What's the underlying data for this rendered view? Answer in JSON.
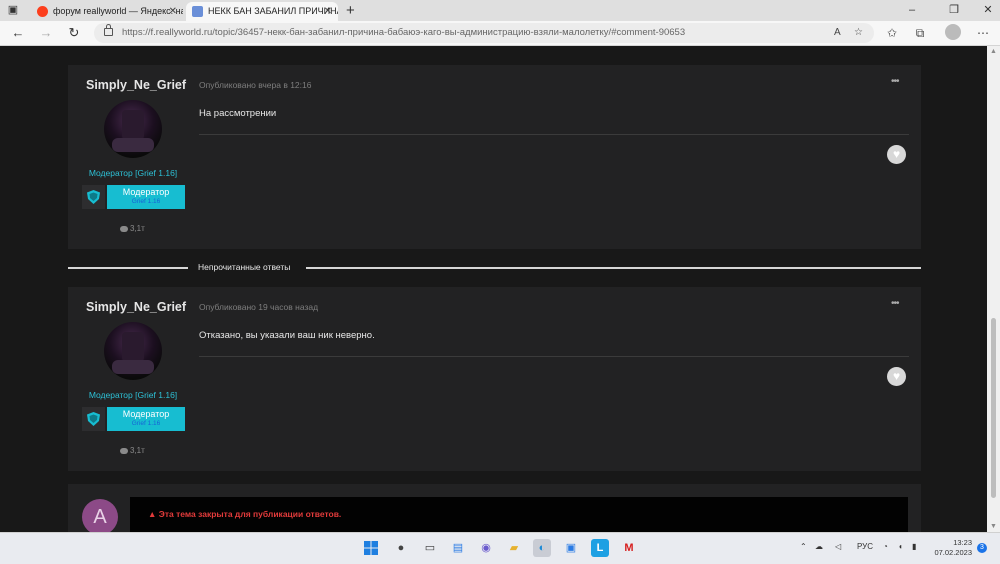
{
  "browser": {
    "tabs": [
      {
        "title": "форум reallyworld — Яндекс: на",
        "active": false
      },
      {
        "title": "НЕКК БАН ЗАБАНИЛ ПРИЧИНА",
        "active": true
      }
    ],
    "url": "https://f.reallyworld.ru/topic/36457-некк-бан-забанил-причина-бабаюэ-каго-вы-администрацию-взяли-малолетку/#comment-90653"
  },
  "posts": [
    {
      "author": "Simply_Ne_Grief",
      "role": "Модератор [Grief 1.16]",
      "badge_title": "Модератор",
      "badge_sub": "Grief 1.16",
      "replies": "3,1т",
      "meta": "Опубликовано вчера в 12:16",
      "body": "На рассмотрении"
    },
    {
      "author": "Simply_Ne_Grief",
      "role": "Модератор [Grief 1.16]",
      "badge_title": "Модератор",
      "badge_sub": "Grief 1.16",
      "replies": "3,1т",
      "meta": "Опубликовано 19 часов назад",
      "body": "Отказано, вы указали ваш ник неверно."
    }
  ],
  "unread_divider": "Непрочитанные ответы",
  "reply": {
    "avatar_letter": "A",
    "locked_message": "Эта тема закрыта для публикации ответов."
  },
  "taskbar": {
    "lang": "РУС",
    "time": "13:23",
    "date": "07.02.2023",
    "notifications": "3"
  },
  "colors": {
    "accent": "#17bdd1",
    "role_text": "#2dc1d6",
    "locked_text": "#e23b3b",
    "avatar_bg": "#8c4a87"
  }
}
